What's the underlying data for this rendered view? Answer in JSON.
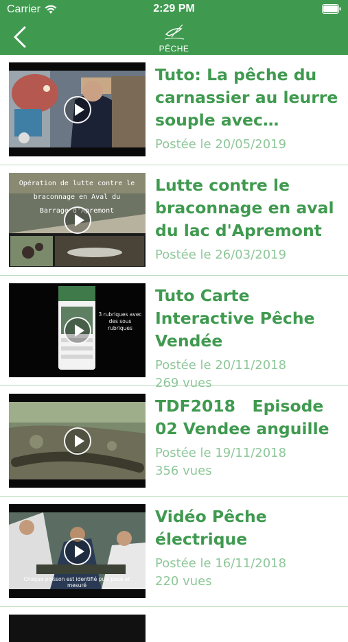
{
  "status_bar": {
    "carrier": "Carrier",
    "time": "2:29 PM"
  },
  "nav": {
    "logo_label": "PÊCHE"
  },
  "videos": [
    {
      "title": "Tuto: La pêche du carnassier au leurre souple avec Laurent…",
      "posted": "Postée le 20/05/2019",
      "views": ""
    },
    {
      "title": "Lutte contre le braconnage en aval du lac d'Apremont",
      "posted": "Postée le 26/03/2019",
      "views": "",
      "thumb_caption": "Opération de lutte contre le braconnage en Aval du Barrage d'Apremont"
    },
    {
      "title": "Tuto Carte Interactive Pêche Vendée",
      "posted": "Postée le 20/11/2018",
      "views": "269 vues",
      "thumb_caption": "3 rubriques avec des sous rubriques"
    },
    {
      "title": "TDF2018   Episode 02 Vendee anguille",
      "posted": "Postée le 19/11/2018",
      "views": "356 vues"
    },
    {
      "title": "Vidéo Pêche électrique",
      "posted": "Postée le 16/11/2018",
      "views": "220 vues",
      "thumb_caption": "Chaque poisson est identifié puis pesé et mesuré"
    }
  ],
  "colors": {
    "brand": "#3f9a4f",
    "meta": "#8fc79a",
    "divider": "#bcdcbf"
  },
  "icons": {
    "back": "chevron-left-icon",
    "play": "play-icon",
    "wifi": "wifi-icon",
    "battery": "battery-icon"
  }
}
